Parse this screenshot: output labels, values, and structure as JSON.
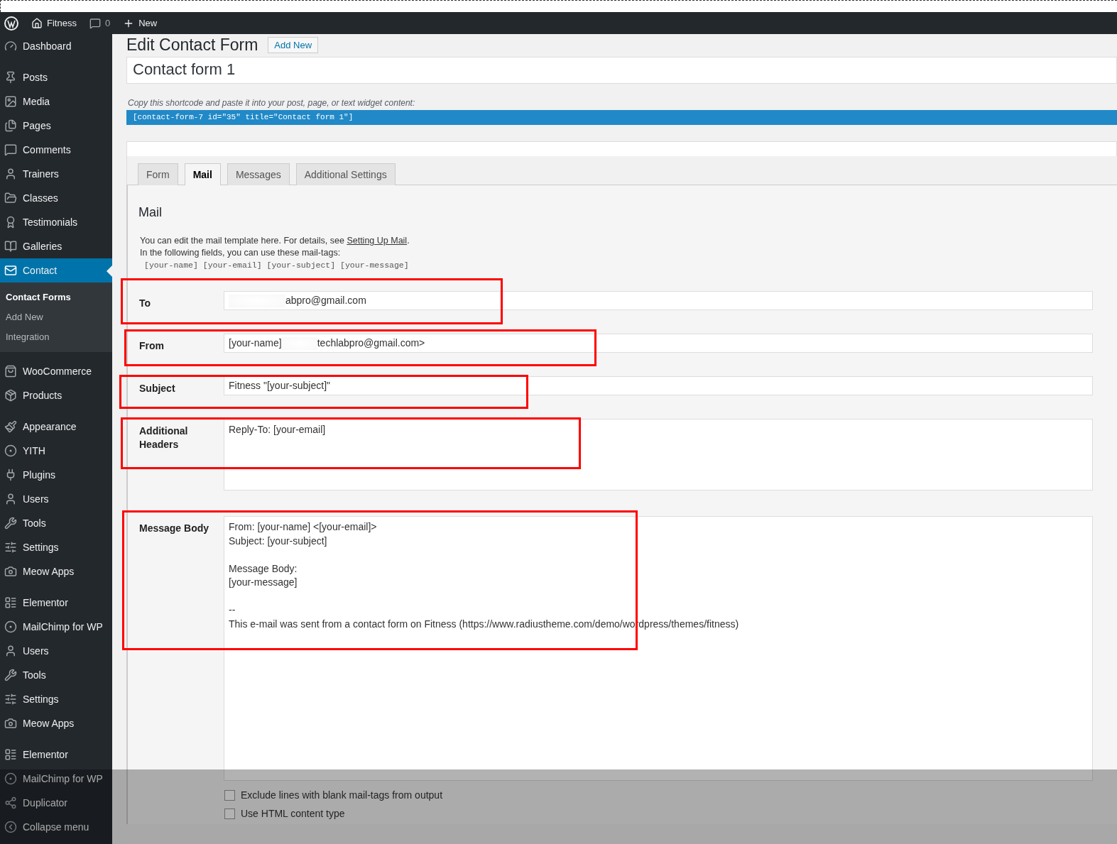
{
  "admin_bar": {
    "site": "Fitness",
    "comments": "0",
    "new": "New"
  },
  "sidebar": {
    "groups": [
      [
        {
          "label": "Dashboard",
          "selected": false
        }
      ],
      [
        {
          "label": "Posts",
          "selected": false
        },
        {
          "label": "Media",
          "selected": false
        },
        {
          "label": "Pages",
          "selected": false
        },
        {
          "label": "Comments",
          "selected": false
        },
        {
          "label": "Trainers",
          "selected": false
        },
        {
          "label": "Classes",
          "selected": false
        },
        {
          "label": "Testimonials",
          "selected": false
        },
        {
          "label": "Galleries",
          "selected": false
        },
        {
          "label": "Contact",
          "selected": true,
          "children": [
            {
              "label": "Contact Forms",
              "selected": true
            },
            {
              "label": "Add New",
              "selected": false
            },
            {
              "label": "Integration",
              "selected": false
            }
          ]
        }
      ],
      [
        {
          "label": "WooCommerce",
          "selected": false
        },
        {
          "label": "Products",
          "selected": false
        }
      ],
      [
        {
          "label": "Appearance",
          "selected": false
        },
        {
          "label": "YITH",
          "selected": false
        },
        {
          "label": "Plugins",
          "selected": false
        },
        {
          "label": "Users",
          "selected": false
        },
        {
          "label": "Tools",
          "selected": false
        },
        {
          "label": "Settings",
          "selected": false
        },
        {
          "label": "Meow Apps",
          "selected": false
        }
      ],
      [
        {
          "label": "Elementor",
          "selected": false
        },
        {
          "label": "MailChimp for WP",
          "selected": false
        },
        {
          "label": "Users",
          "selected": false
        },
        {
          "label": "Tools",
          "selected": false
        },
        {
          "label": "Settings",
          "selected": false
        },
        {
          "label": "Meow Apps",
          "selected": false
        }
      ],
      [
        {
          "label": "Elementor",
          "selected": false
        },
        {
          "label": "MailChimp for WP",
          "selected": false
        },
        {
          "label": "Duplicator",
          "selected": false
        },
        {
          "label": "Collapse menu",
          "selected": false
        }
      ]
    ]
  },
  "page": {
    "heading": "Edit Contact Form",
    "add_new": "Add New",
    "title_value": "Contact form 1",
    "shortcode_hint": "Copy this shortcode and paste it into your post, page, or text widget content:",
    "shortcode": "[contact-form-7 id=\"35\" title=\"Contact form 1\"]"
  },
  "tabs": [
    {
      "label": "Form",
      "selected": false
    },
    {
      "label": "Mail",
      "selected": true
    },
    {
      "label": "Messages",
      "selected": false
    },
    {
      "label": "Additional Settings",
      "selected": false
    }
  ],
  "mail": {
    "title": "Mail",
    "intro": "You can edit the mail template here. For details, see ",
    "intro_link": "Setting Up Mail",
    "intro_end": ".",
    "tags_hint": "In the following fields, you can use these mail-tags:",
    "tags": "[your-name] [your-email] [your-subject] [your-message]",
    "fields": [
      {
        "label": "To",
        "kind": "line",
        "highlighted": true,
        "segments": [
          {
            "kind": "redacted"
          },
          {
            "kind": "text",
            "text": "abpro@gmail.com"
          }
        ]
      },
      {
        "label": "From",
        "kind": "line",
        "highlighted": true,
        "segments": [
          {
            "kind": "text",
            "text": "[your-name]"
          },
          {
            "kind": "redacted"
          },
          {
            "kind": "text",
            "text": "techlabpro@gmail.com>"
          }
        ]
      },
      {
        "label": "Subject",
        "kind": "line",
        "highlighted": true,
        "segments": [
          {
            "kind": "text",
            "text": "Fitness \"[your-subject]\""
          }
        ]
      },
      {
        "label": "Additional Headers",
        "kind": "area",
        "highlighted": true,
        "segments": [
          {
            "kind": "text",
            "text": "Reply-To: [your-email]"
          }
        ]
      },
      {
        "label": "Message Body",
        "kind": "big",
        "highlighted": true,
        "segments": [
          {
            "kind": "text",
            "text": "From: [your-name] <[your-email]>\nSubject: [your-subject]\n\nMessage Body:\n[your-message]\n\n--\nThis e-mail was sent from a contact form on Fitness (https://www.radiustheme.com/demo/wordpress/themes/fitness)"
          }
        ]
      }
    ],
    "options": [
      {
        "label": "Exclude lines with blank mail-tags from output",
        "checked": false
      },
      {
        "label": "Use HTML content type",
        "checked": false
      }
    ]
  }
}
